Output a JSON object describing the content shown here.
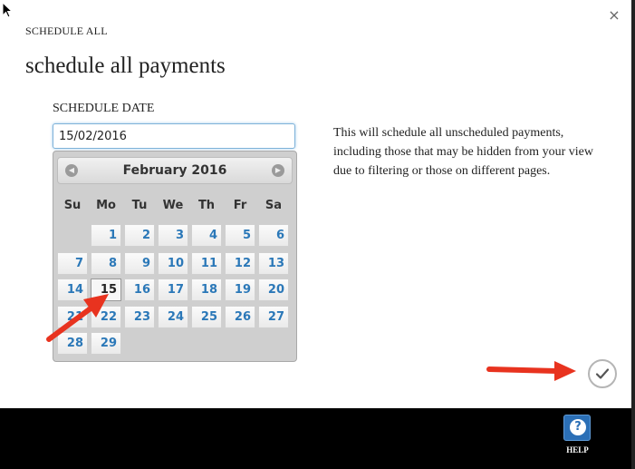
{
  "header": {
    "label": "SCHEDULE ALL",
    "close_icon": "close-icon",
    "close_glyph": "×"
  },
  "main": {
    "title": "schedule all payments",
    "field_label": "SCHEDULE DATE",
    "date_value": "15/02/2016",
    "info_text": "This will schedule all unscheduled payments, including those that may be hidden from your view due to filtering or those on different pages."
  },
  "datepicker": {
    "month_title": "February 2016",
    "prev_icon": "chevron-left-icon",
    "next_icon": "chevron-right-icon",
    "weekdays": [
      "Su",
      "Mo",
      "Tu",
      "We",
      "Th",
      "Fr",
      "Sa"
    ],
    "first_weekday_index": 1,
    "days": [
      "1",
      "2",
      "3",
      "4",
      "5",
      "6",
      "7",
      "8",
      "9",
      "10",
      "11",
      "12",
      "13",
      "14",
      "15",
      "16",
      "17",
      "18",
      "19",
      "20",
      "21",
      "22",
      "23",
      "24",
      "25",
      "26",
      "27",
      "28",
      "29"
    ],
    "selected_day": "15"
  },
  "actions": {
    "confirm_icon": "checkmark-icon"
  },
  "footer": {
    "help_icon": "help-icon",
    "help_glyph": "?",
    "help_label": "HELP"
  },
  "colors": {
    "accent_blue": "#2b78b8",
    "annotation_arrow": "#e8331f",
    "footer_bg": "#000000"
  }
}
